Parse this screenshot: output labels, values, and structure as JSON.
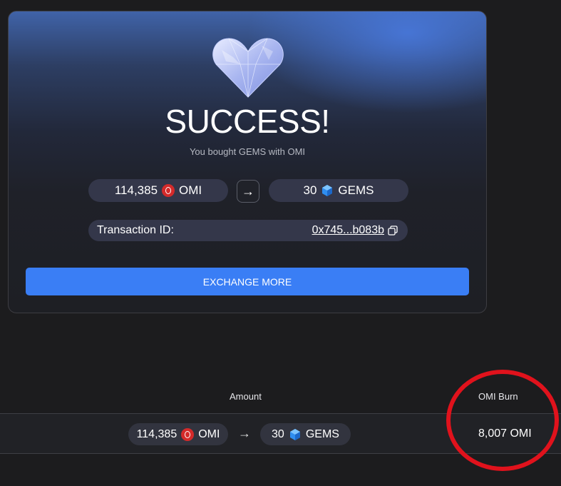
{
  "success_card": {
    "title": "SUCCESS!",
    "subtitle": "You bought GEMS with OMI",
    "from": {
      "amount": "114,385",
      "currency": "OMI",
      "icon": "omi-coin-icon"
    },
    "to": {
      "amount": "30",
      "currency": "GEMS",
      "icon": "gem-icon"
    },
    "arrow": "→",
    "transaction": {
      "label": "Transaction ID:",
      "id": "0x745...b083b"
    },
    "exchange_more_label": "EXCHANGE MORE"
  },
  "table": {
    "headers": {
      "amount": "Amount",
      "omi_burn": "OMI Burn"
    },
    "row": {
      "from_amount": "114,385",
      "from_currency": "OMI",
      "arrow": "→",
      "to_amount": "30",
      "to_currency": "GEMS",
      "omi_burn": "8,007 OMI"
    }
  },
  "colors": {
    "accent": "#3a7ef5",
    "omi_red": "#d42a2a",
    "gem_blue": "#2f8ef0",
    "annotation_red": "#e0121c"
  }
}
